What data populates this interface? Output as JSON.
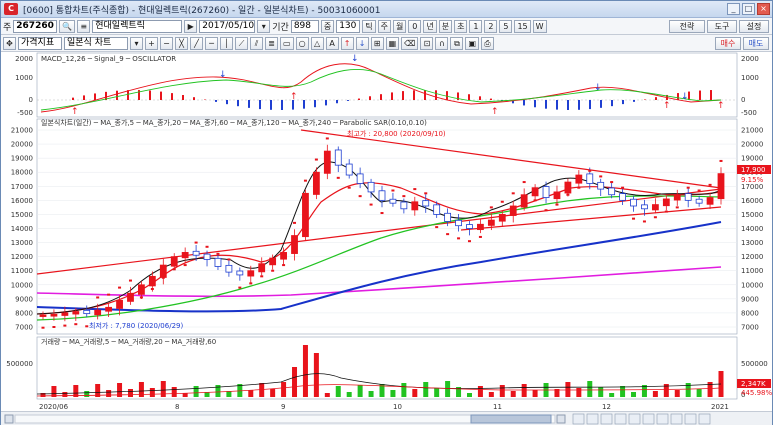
{
  "window": {
    "app_badge": "C",
    "title": "[0600] 통합차트(주식종합) - 현대일렉트릭(267260) - 일간 - 일본식차트) - 50031060001"
  },
  "toolbar1": {
    "prefix": "주",
    "code": "267260",
    "name": "현대일렉트릭",
    "date": "2017/05/10",
    "period_label": "기간",
    "period_value": "898",
    "count_label": "중",
    "count_value": "130",
    "units": [
      "틱",
      "주",
      "월",
      "0",
      "년",
      "분",
      "초",
      "1",
      "2",
      "5",
      "15",
      "W"
    ],
    "right_buttons": [
      "전략",
      "도구",
      "설정"
    ]
  },
  "toolbar2": {
    "price_index": "가격지표",
    "chart_type": "일본식 차트",
    "right_buttons": [
      "매수",
      "매도"
    ]
  },
  "macd_panel": {
    "legend": "MACD_12,26 ─ Signal_9 ─ OSCILLATOR",
    "ticks": [
      "2000",
      "1000",
      "0",
      "-500"
    ]
  },
  "price_panel": {
    "legend": "일본식차트(일간) ─ MA_종가,5 ─ MA_종가,20 ─ MA_종가,60 ─ MA_종가,120 ─ MA_종가,240 ─ Parabolic SAR(0.10,0.10)",
    "high_label": "최고가 : 20,800 (2020/09/10)",
    "low_label": "최저가 : 7,780 (2020/06/29)",
    "ticks": [
      "21000",
      "20000",
      "19000",
      "18000",
      "17000",
      "16000",
      "15000",
      "14000",
      "13000",
      "12000",
      "11000",
      "10000",
      "9000",
      "8000",
      "7000"
    ],
    "current_price": "17,900",
    "change_pct": "9.15%"
  },
  "volume_panel": {
    "legend": "거래량 ─ MA_거래량,5 ─ MA_거래량,20 ─ MA_거래량,60",
    "ticks": [
      "500000",
      "0"
    ],
    "current_volume": "2,347K",
    "volume_pct": "445.98%"
  },
  "x_axis": {
    "labels": [
      "2020/06",
      "8",
      "9",
      "10",
      "11",
      "12",
      "2021"
    ]
  },
  "colors": {
    "up": "#e8141c",
    "down": "#1f3fd1",
    "ma20": "#e8141c",
    "ma60": "#22c322",
    "ma120": "#1732c9",
    "ma240": "#e11de0"
  }
}
